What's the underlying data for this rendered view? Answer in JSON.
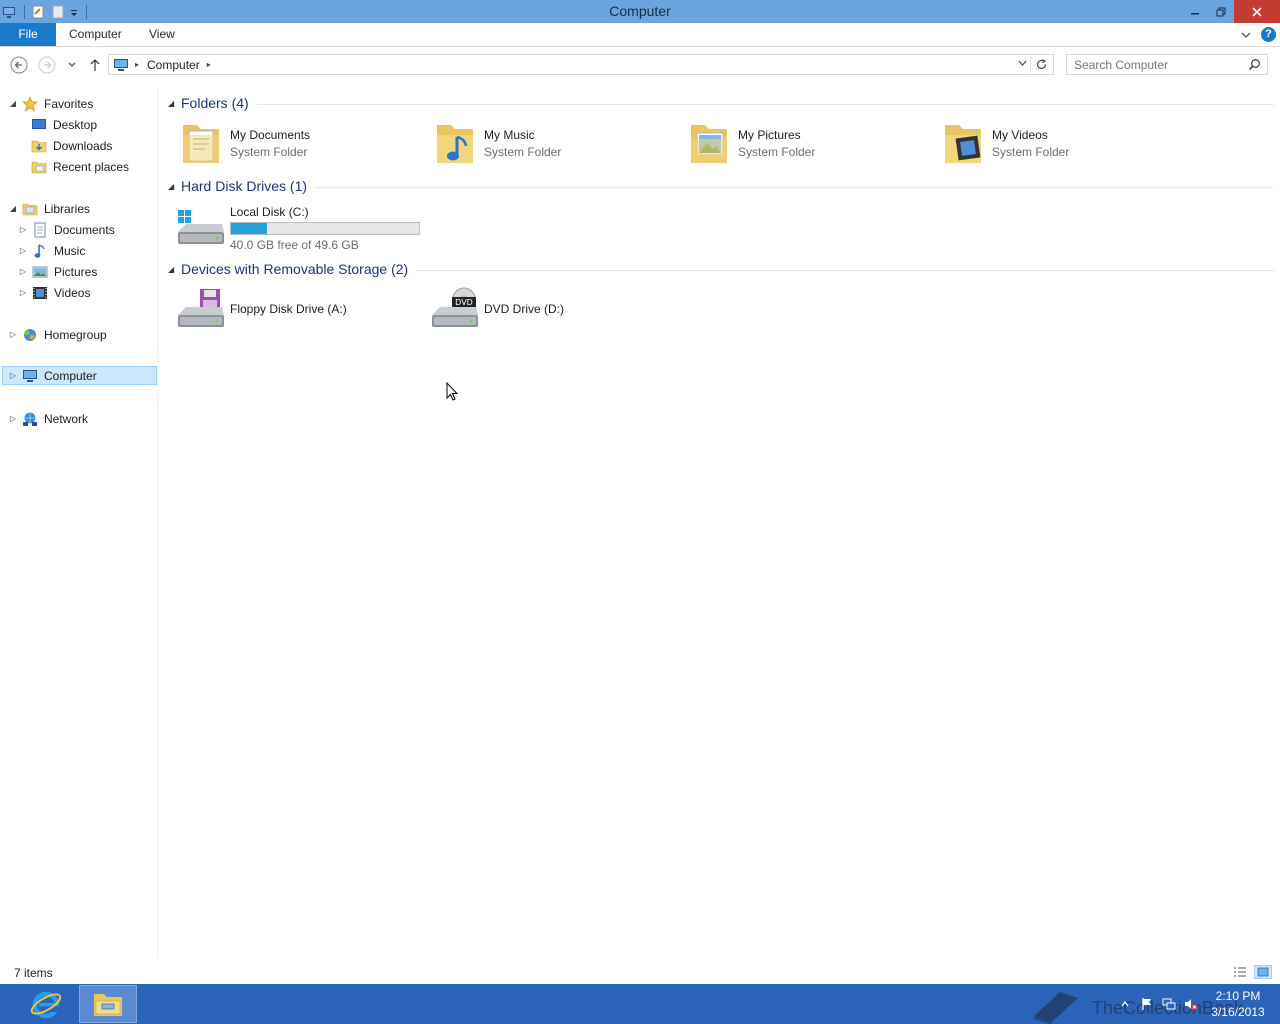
{
  "window": {
    "title": "Computer"
  },
  "ribbon": {
    "tabs": [
      "File",
      "Computer",
      "View"
    ]
  },
  "address": {
    "crumb": "Computer",
    "search_placeholder": "Search Computer"
  },
  "navpane": {
    "favorites": {
      "label": "Favorites",
      "items": [
        "Desktop",
        "Downloads",
        "Recent places"
      ]
    },
    "libraries": {
      "label": "Libraries",
      "items": [
        "Documents",
        "Music",
        "Pictures",
        "Videos"
      ]
    },
    "homegroup": "Homegroup",
    "computer": "Computer",
    "network": "Network"
  },
  "groups": {
    "folders": {
      "title": "Folders (4)",
      "items": [
        {
          "name": "My Documents",
          "sub": "System Folder"
        },
        {
          "name": "My Music",
          "sub": "System Folder"
        },
        {
          "name": "My Pictures",
          "sub": "System Folder"
        },
        {
          "name": "My Videos",
          "sub": "System Folder"
        }
      ]
    },
    "drives": {
      "title": "Hard Disk Drives (1)",
      "items": [
        {
          "name": "Local Disk (C:)",
          "free": "40.0 GB free of 49.6 GB",
          "used_fraction": 0.19
        }
      ]
    },
    "removable": {
      "title": "Devices with Removable Storage (2)",
      "items": [
        {
          "name": "Floppy Disk Drive (A:)"
        },
        {
          "name": "DVD Drive (D:)"
        }
      ]
    }
  },
  "status": {
    "count": "7 items"
  },
  "taskbar": {
    "clock_time": "2:10 PM",
    "clock_date": "3/16/2013",
    "watermark": "TheCollectionBook"
  },
  "colors": {
    "accent": "#1979ca",
    "titlebar": "#6aa5e0",
    "taskbar": "#2a63b8",
    "usage_bar": "#26a0da"
  }
}
